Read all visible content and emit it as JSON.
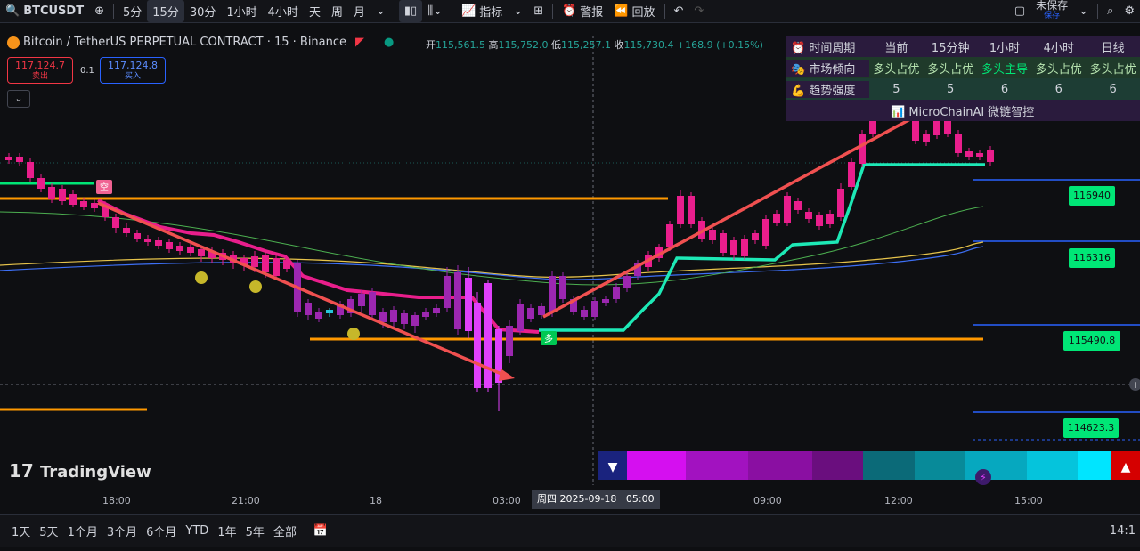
{
  "toolbar": {
    "symbol": "BTCUSDT",
    "intervals": [
      "5分",
      "15分",
      "30分",
      "1小时",
      "4小时",
      "天",
      "周",
      "月"
    ],
    "active_interval": "15分",
    "indicators_label": "指标",
    "alert_label": "警报",
    "replay_label": "回放",
    "unsaved_label": "未保存",
    "saved_sub": "保存"
  },
  "legend": {
    "title": "Bitcoin / TetherUS PERPETUAL CONTRACT · 15 · Binance",
    "open_label": "开",
    "open": "115,561.5",
    "high_label": "高",
    "high": "115,752.0",
    "low_label": "低",
    "low": "115,257.1",
    "close_label": "收",
    "close": "115,730.4",
    "change": "+168.9 (+0.15%)"
  },
  "sell": {
    "price": "117,124.7",
    "label": "卖出"
  },
  "spread": "0.1",
  "buy": {
    "price": "117,124.8",
    "label": "买入"
  },
  "signal_table": {
    "headers": [
      "时间周期",
      "当前",
      "15分钟",
      "1小时",
      "4小时",
      "日线"
    ],
    "trend_label": "市场倾向",
    "trend": [
      "多头占优",
      "多头占优",
      "多头主导",
      "多头占优",
      "多头占优"
    ],
    "strength_label": "趋势强度",
    "strength": [
      "5",
      "5",
      "6",
      "6",
      "6"
    ],
    "brand": "MicroChainAI 微链智控"
  },
  "markers": {
    "short": "空",
    "long": "多"
  },
  "price_labels": [
    "116940",
    "116316",
    "115490.8",
    "114623.3"
  ],
  "x_labels": [
    "18:00",
    "21:00",
    "18",
    "03:00",
    "09:00",
    "12:00",
    "15:00"
  ],
  "crosshair_label": "周四 2025-09-18   05:00",
  "watermark": "TradingView",
  "ranges": [
    "1天",
    "5天",
    "1个月",
    "3个月",
    "6个月",
    "YTD",
    "1年",
    "5年",
    "全部"
  ],
  "clock": "14:1",
  "colors": {
    "bull": "#26c6da",
    "bear": "#e91e8c",
    "support": "#00e676",
    "level": "#ff9800",
    "trend_arrow": "#ff5252"
  }
}
